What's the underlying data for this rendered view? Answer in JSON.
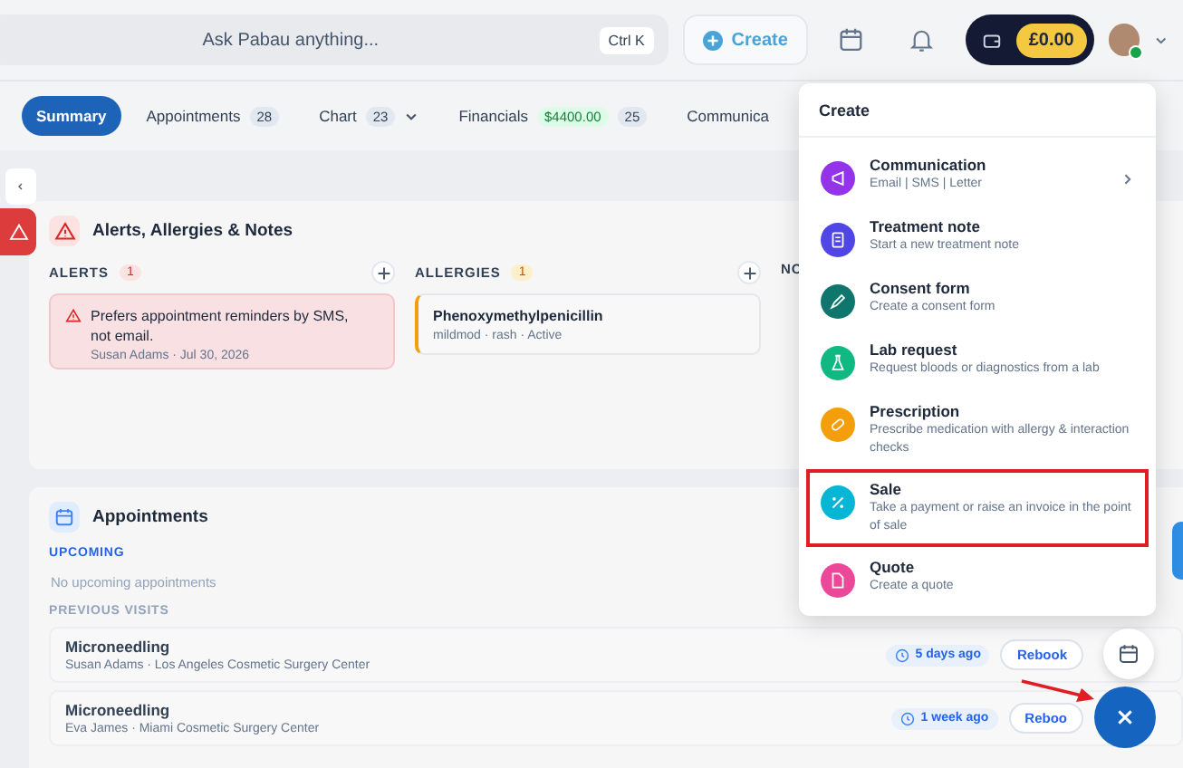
{
  "topbar": {
    "search": {
      "placeholder": "Ask Pabau anything...",
      "shortcut": "Ctrl K"
    },
    "create_button": "Create",
    "balance": "£0.00",
    "avatar": {
      "online": true
    }
  },
  "tabs": [
    {
      "label": "Summary",
      "selected": true
    },
    {
      "label": "Appointments",
      "count": "28",
      "selected": false
    },
    {
      "label": "Chart",
      "count": "23",
      "dropdown": true,
      "selected": false
    },
    {
      "label": "Financials",
      "amount": "$4400.00",
      "count": "25",
      "selected": false
    },
    {
      "label": "Communica",
      "selected": false
    }
  ],
  "alerts_panel": {
    "title": "Alerts, Allergies & Notes",
    "columns": [
      {
        "kind": "alerts",
        "title": "ALERTS",
        "count": "1",
        "items": [
          {
            "text": "Prefers appointment reminders by SMS, not email.",
            "meta": "Susan Adams · Jul 30, 2026"
          }
        ]
      },
      {
        "kind": "allergies",
        "title": "ALLERGIES",
        "count": "1",
        "items": [
          {
            "text": "Phenoxymethylpenicillin",
            "meta": "mildmod · rash · Active"
          }
        ]
      },
      {
        "kind": "notes",
        "title": "NO"
      }
    ]
  },
  "appointments_panel": {
    "title": "Appointments",
    "upcoming_label": "UPCOMING",
    "upcoming_empty": "No upcoming appointments",
    "previous_label": "PREVIOUS VISITS",
    "visits": [
      {
        "title": "Microneedling",
        "subtitle": "Susan Adams · Los Angeles Cosmetic Surgery Center",
        "when": "5 days ago",
        "action": "Rebook"
      },
      {
        "title": "Microneedling",
        "subtitle": "Eva James · Miami Cosmetic Surgery Center",
        "when": "1 week ago",
        "action": "Reboo"
      }
    ]
  },
  "create_menu": {
    "title": "Create",
    "items": [
      {
        "kind": "communication",
        "title": "Communication",
        "subtitle": "Email | SMS | Letter",
        "color": "#9333ea",
        "submenu": true,
        "highlighted": false
      },
      {
        "kind": "note",
        "title": "Treatment note",
        "subtitle": "Start a new treatment note",
        "color": "#4f46e5",
        "submenu": false,
        "highlighted": false
      },
      {
        "kind": "consent",
        "title": "Consent form",
        "subtitle": "Create a consent form",
        "color": "#0f766e",
        "submenu": false,
        "highlighted": false
      },
      {
        "kind": "lab",
        "title": "Lab request",
        "subtitle": "Request bloods or diagnostics from a lab",
        "color": "#10b981",
        "submenu": false,
        "highlighted": false
      },
      {
        "kind": "prescription",
        "title": "Prescription",
        "subtitle": "Prescribe medication with allergy & interaction checks",
        "color": "#f59e0b",
        "submenu": false,
        "highlighted": false
      },
      {
        "kind": "sale",
        "title": "Sale",
        "subtitle": "Take a payment or raise an invoice in the point of sale",
        "color": "#06b6d4",
        "submenu": false,
        "highlighted": true
      },
      {
        "kind": "quote",
        "title": "Quote",
        "subtitle": "Create a quote",
        "color": "#ec4899",
        "submenu": false,
        "highlighted": false
      }
    ]
  }
}
